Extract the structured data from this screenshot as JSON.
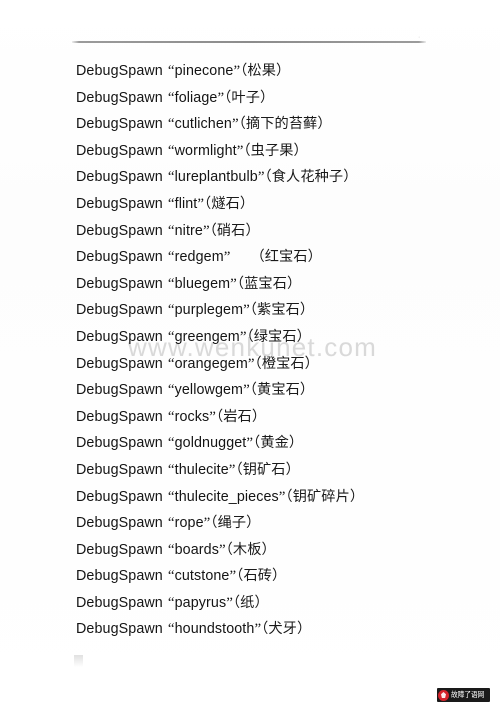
{
  "document": {
    "type": "scanned-text-page",
    "background_color": "#fefefe",
    "text_color": "#1b1b1b",
    "rule_color": "#8c8c8c"
  },
  "watermark": {
    "text": "www.wenkunet.com",
    "color": "#a8a8a8"
  },
  "header": {
    "rule_tick": "·"
  },
  "commands": [
    {
      "keyword": "DebugSpawn",
      "open_quote": "“",
      "id": "pinecone",
      "close_quote": "”",
      "spacer": "",
      "cn": "（松果）"
    },
    {
      "keyword": "DebugSpawn",
      "open_quote": "“",
      "id": "foliage",
      "close_quote": "”",
      "spacer": "",
      "cn": "（叶子）"
    },
    {
      "keyword": "DebugSpawn",
      "open_quote": "“",
      "id": "cutlichen",
      "close_quote": "”",
      "spacer": "",
      "cn": "（摘下的苔藓）"
    },
    {
      "keyword": "DebugSpawn",
      "open_quote": "“",
      "id": "wormlight",
      "close_quote": "”",
      "spacer": "",
      "cn": "（虫子果）"
    },
    {
      "keyword": "DebugSpawn",
      "open_quote": "“",
      "id": "lureplantbulb",
      "close_quote": "”",
      "spacer": "",
      "cn": "（食人花种子）"
    },
    {
      "keyword": "DebugSpawn",
      "open_quote": "“",
      "id": "flint",
      "close_quote": "”",
      "spacer": "",
      "cn": "（燧石）"
    },
    {
      "keyword": "DebugSpawn",
      "open_quote": "“",
      "id": "nitre",
      "close_quote": "”",
      "spacer": "",
      "cn": "（硝石）"
    },
    {
      "keyword": "DebugSpawn",
      "open_quote": "“",
      "id": "redgem",
      "close_quote": "”",
      "spacer": "wide",
      "cn": "（红宝石）"
    },
    {
      "keyword": "DebugSpawn",
      "open_quote": "“",
      "id": "bluegem",
      "close_quote": "”",
      "spacer": "",
      "cn": "（蓝宝石）"
    },
    {
      "keyword": "DebugSpawn",
      "open_quote": "“",
      "id": "purplegem",
      "close_quote": "”",
      "spacer": "",
      "cn": "（紫宝石）"
    },
    {
      "keyword": "DebugSpawn",
      "open_quote": "“",
      "id": "greengem",
      "close_quote": "”",
      "spacer": "",
      "cn": "（绿宝石）"
    },
    {
      "keyword": "DebugSpawn",
      "open_quote": "“",
      "id": "orangegem",
      "close_quote": "”",
      "spacer": "",
      "cn": "（橙宝石）"
    },
    {
      "keyword": "DebugSpawn",
      "open_quote": "“",
      "id": "yellowgem",
      "close_quote": "”",
      "spacer": "",
      "cn": "（黄宝石）"
    },
    {
      "keyword": "DebugSpawn",
      "open_quote": "“",
      "id": "rocks",
      "close_quote": "”",
      "spacer": "",
      "cn": "（岩石）"
    },
    {
      "keyword": "DebugSpawn",
      "open_quote": "“",
      "id": "goldnugget",
      "close_quote": "”",
      "spacer": "",
      "cn": "（黄金）"
    },
    {
      "keyword": "DebugSpawn",
      "open_quote": "“",
      "id": "thulecite",
      "close_quote": "”",
      "spacer": "",
      "cn": "（钥矿石）"
    },
    {
      "keyword": "DebugSpawn",
      "open_quote": "“",
      "id": "thulecite_pieces",
      "close_quote": "”",
      "spacer": "",
      "cn": "（钥矿碎片）"
    },
    {
      "keyword": "DebugSpawn",
      "open_quote": "“",
      "id": "rope",
      "close_quote": "”",
      "spacer": "",
      "cn": "（绳子）"
    },
    {
      "keyword": "DebugSpawn",
      "open_quote": "“",
      "id": "boards",
      "close_quote": "”",
      "spacer": "",
      "cn": "（木板）"
    },
    {
      "keyword": "DebugSpawn",
      "open_quote": "“",
      "id": "cutstone",
      "close_quote": "”",
      "spacer": "",
      "cn": "（石砖）"
    },
    {
      "keyword": "DebugSpawn",
      "open_quote": "“",
      "id": "papyrus",
      "close_quote": "”",
      "spacer": "",
      "cn": "（纸）"
    },
    {
      "keyword": "DebugSpawn",
      "open_quote": "“",
      "id": "houndstooth",
      "close_quote": "”",
      "spacer": "",
      "cn": "（犬牙）"
    }
  ],
  "site_badge": {
    "text": "故障了语网",
    "icon": "circle-logo-icon",
    "background_color": "#1a1a1a",
    "mark_color": "#d4232b"
  }
}
